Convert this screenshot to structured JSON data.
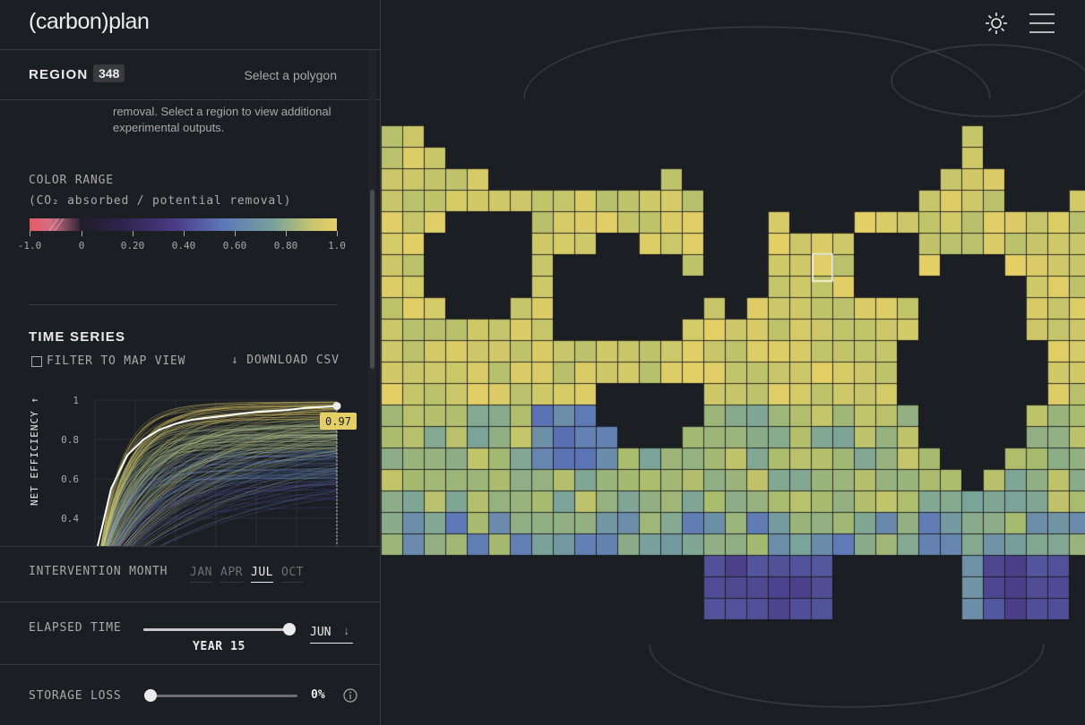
{
  "app": {
    "logo": "(carbon)plan"
  },
  "region": {
    "title": "REGION",
    "count": "348",
    "hint": "Select a polygon"
  },
  "description": "removal. Select a region to view additional experimental outputs.",
  "color_range": {
    "title": "COLOR RANGE",
    "subtitle": "(CO₂ absorbed / potential removal)",
    "ticks": [
      "-1.0",
      "0",
      "0.20",
      "0.40",
      "0.60",
      "0.80",
      "1.0"
    ]
  },
  "time_series": {
    "title": "TIME SERIES",
    "filter_label": "FILTER TO MAP VIEW",
    "download_label": "↓ DOWNLOAD CSV",
    "ylabel": "NET EFFICIENCY ↑",
    "value_badge": "0.97"
  },
  "chart_data": {
    "type": "line",
    "ylabel": "NET EFFICIENCY",
    "y_ticks": [
      "1",
      "0.8",
      "0.6",
      "0.4"
    ],
    "ylim": [
      0.3,
      1.0
    ],
    "series": [
      {
        "values": [
          0.2,
          0.55,
          0.72,
          0.8,
          0.85,
          0.88,
          0.9,
          0.91,
          0.92,
          0.93,
          0.94,
          0.945,
          0.95,
          0.96,
          0.965,
          0.97
        ]
      }
    ],
    "highlight_value": 0.97,
    "colors": {
      "selected": "#ffffff",
      "high": "#e3cf66",
      "mid": "#5d78b8",
      "low": "#4a3a86"
    }
  },
  "controls": {
    "intervention_month": {
      "label": "INTERVENTION MONTH",
      "options": [
        "JAN",
        "APR",
        "JUL",
        "OCT"
      ],
      "selected": "JUL"
    },
    "elapsed_time": {
      "label": "ELAPSED TIME",
      "value_label": "YEAR 15",
      "month": "JUN",
      "fraction": 1.0
    },
    "storage_loss": {
      "label": "STORAGE LOSS",
      "value": "0%",
      "fraction": 0.0
    }
  },
  "icons": {
    "theme": "sun-icon",
    "menu": "hamburger-icon",
    "info": "info-icon"
  }
}
